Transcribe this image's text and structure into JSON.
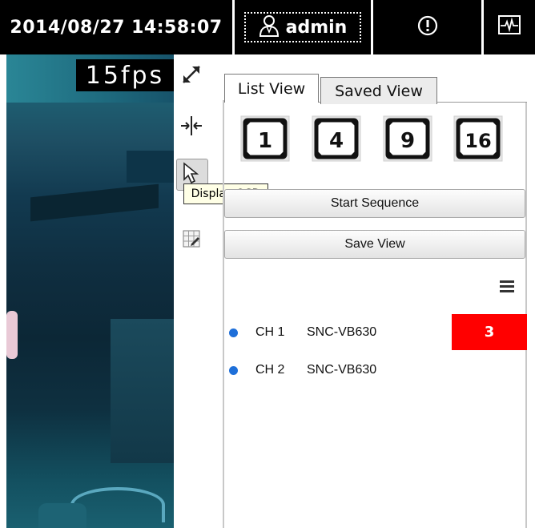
{
  "topbar": {
    "datetime": "2014/08/27 14:58:07",
    "username": "admin",
    "user_icon": "user-icon",
    "alert_icon": "alert-icon",
    "monitor_icon": "activity-monitor-icon"
  },
  "video": {
    "fps": "15fps"
  },
  "toolbar": {
    "fullscreen_icon": "expand-icon",
    "split_icon": "split-icon",
    "osd_icon": "cursor-icon",
    "grid_icon": "grid-edit-icon",
    "tooltip": "Display OSD"
  },
  "tabs": {
    "list_view": "List View",
    "saved_view": "Saved View"
  },
  "layouts": [
    "1",
    "4",
    "9",
    "16"
  ],
  "buttons": {
    "start_sequence": "Start Sequence",
    "save_view": "Save View"
  },
  "channels": [
    {
      "name": "CH 1",
      "model": "SNC-VB630",
      "badge": "3"
    },
    {
      "name": "CH 2",
      "model": "SNC-VB630"
    }
  ],
  "colors": {
    "status_dot": "#1e6fd9",
    "badge": "#ff0000"
  }
}
